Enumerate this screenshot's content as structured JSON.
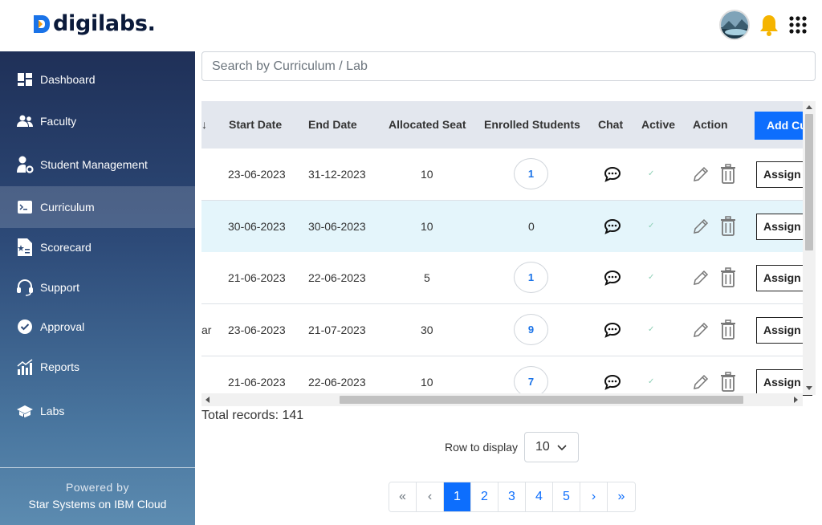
{
  "brand": {
    "name": "digilabs.",
    "logo_letter": "D"
  },
  "header": {
    "avatar_icon": "user-avatar",
    "bell_icon": "bell-icon",
    "apps_icon": "apps-grid-icon"
  },
  "sidebar": {
    "items": [
      {
        "label": "Dashboard",
        "icon": "dashboard-icon"
      },
      {
        "label": "Faculty",
        "icon": "users-icon"
      },
      {
        "label": "Student Management",
        "icon": "user-gear-icon"
      },
      {
        "label": "Curriculum",
        "icon": "terminal-icon",
        "active": true
      },
      {
        "label": "Scorecard",
        "icon": "scorecard-icon"
      },
      {
        "label": "Support",
        "icon": "headset-icon"
      },
      {
        "label": "Approval",
        "icon": "check-circle-icon"
      },
      {
        "label": "Reports",
        "icon": "chart-icon"
      },
      {
        "label": "Labs",
        "icon": "labs-icon"
      }
    ],
    "powered_by": "Powered by",
    "powered_company": "Star Systems on IBM Cloud"
  },
  "search": {
    "placeholder": "Search by Curriculum / Lab",
    "value": ""
  },
  "table": {
    "sort_arrow": "↓",
    "columns": [
      "Start Date",
      "End Date",
      "Allocated Seat",
      "Enrolled Students",
      "Chat",
      "Active",
      "Action"
    ],
    "add_button": "Add Cu",
    "rows": [
      {
        "prefix": "",
        "start": "23-06-2023",
        "end": "31-12-2023",
        "seats": "10",
        "enrolled": "1",
        "badge": true,
        "assign": "Assign"
      },
      {
        "prefix": "",
        "start": "30-06-2023",
        "end": "30-06-2023",
        "seats": "10",
        "enrolled": "0",
        "badge": false,
        "assign": "Assign"
      },
      {
        "prefix": "",
        "start": "21-06-2023",
        "end": "22-06-2023",
        "seats": "5",
        "enrolled": "1",
        "badge": true,
        "assign": "Assign"
      },
      {
        "prefix": "ar",
        "start": "23-06-2023",
        "end": "21-07-2023",
        "seats": "30",
        "enrolled": "9",
        "badge": true,
        "assign": "Assign"
      },
      {
        "prefix": "",
        "start": "21-06-2023",
        "end": "22-06-2023",
        "seats": "10",
        "enrolled": "7",
        "badge": true,
        "assign": "Assign"
      }
    ],
    "active_mark": "✓"
  },
  "footer": {
    "total_records": "Total records: 141",
    "row_display_label": "Row to display",
    "row_display_value": "10",
    "pages": [
      "«",
      "‹",
      "1",
      "2",
      "3",
      "4",
      "5",
      "›",
      "»"
    ],
    "current_page": "1"
  },
  "colors": {
    "accent": "#0d6efd",
    "highlight_row": "#e4f5fb",
    "header_bg": "#e3e7ee",
    "bell": "#f5b400"
  }
}
